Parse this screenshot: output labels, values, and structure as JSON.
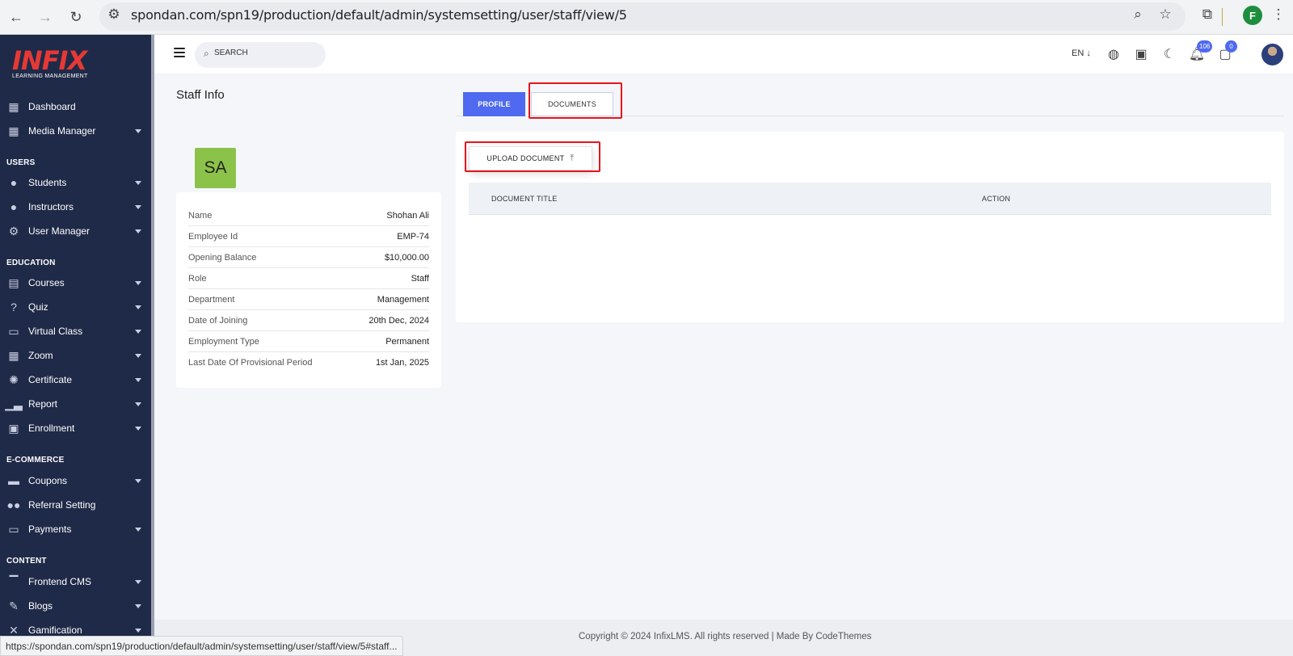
{
  "browser": {
    "url": "spondan.com/spn19/production/default/admin/systemsetting/user/staff/view/5",
    "profile_initial": "F"
  },
  "logo": {
    "title": "INFIX",
    "subtitle": "LEARNING MANAGEMENT"
  },
  "sidebar": {
    "items": [
      {
        "label": "Dashboard",
        "icon": "grid-icon"
      },
      {
        "label": "Media Manager",
        "icon": "grid-icon"
      },
      {
        "label": "Students",
        "icon": "user-icon"
      },
      {
        "label": "Instructors",
        "icon": "user-icon"
      },
      {
        "label": "User Manager",
        "icon": "user-gear-icon"
      },
      {
        "label": "Courses",
        "icon": "book-icon"
      },
      {
        "label": "Quiz",
        "icon": "question-icon"
      },
      {
        "label": "Virtual Class",
        "icon": "vr-icon"
      },
      {
        "label": "Zoom",
        "icon": "grid-icon"
      },
      {
        "label": "Certificate",
        "icon": "badge-icon"
      },
      {
        "label": "Report",
        "icon": "chart-icon"
      },
      {
        "label": "Enrollment",
        "icon": "enroll-icon"
      },
      {
        "label": "Coupons",
        "icon": "ticket-icon"
      },
      {
        "label": "Referral Setting",
        "icon": "users-icon"
      },
      {
        "label": "Payments",
        "icon": "money-icon"
      },
      {
        "label": "Frontend CMS",
        "icon": "paint-roller-icon"
      },
      {
        "label": "Blogs",
        "icon": "pencil-icon"
      },
      {
        "label": "Gamification",
        "icon": "trophy-icon"
      }
    ],
    "sections": [
      "USERS",
      "EDUCATION",
      "E-COMMERCE",
      "CONTENT"
    ]
  },
  "header": {
    "search_placeholder": "SEARCH",
    "language": "EN ↓",
    "notifications_count": "106",
    "messages_count": "0"
  },
  "page": {
    "title": "Staff Info",
    "avatar_initials": "SA"
  },
  "staff_info": {
    "rows": [
      {
        "label": "Name",
        "value": "Shohan Ali"
      },
      {
        "label": "Employee Id",
        "value": "EMP-74"
      },
      {
        "label": "Opening Balance",
        "value": "$10,000.00"
      },
      {
        "label": "Role",
        "value": "Staff"
      },
      {
        "label": "Department",
        "value": "Management"
      },
      {
        "label": "Date of Joining",
        "value": "20th Dec, 2024"
      },
      {
        "label": "Employment Type",
        "value": "Permanent"
      },
      {
        "label": "Last Date Of Provisional Period",
        "value": "1st Jan, 2025"
      }
    ]
  },
  "tabs": {
    "profile": "PROFILE",
    "documents": "DOCUMENTS"
  },
  "documents": {
    "upload_label": "UPLOAD DOCUMENT",
    "columns": [
      "DOCUMENT TITLE",
      "ACTION"
    ]
  },
  "footer": {
    "text": "Copyright © 2024 InfixLMS. All rights reserved | Made By CodeThemes"
  },
  "status_bar": {
    "url": "https://spondan.com/spn19/production/default/admin/systemsetting/user/staff/view/5#staff..."
  },
  "colors": {
    "sidebar_bg": "#1f2a48",
    "accent": "#4f6af0",
    "highlight": "#e8131b",
    "avatar_bg": "#8bc34a"
  }
}
